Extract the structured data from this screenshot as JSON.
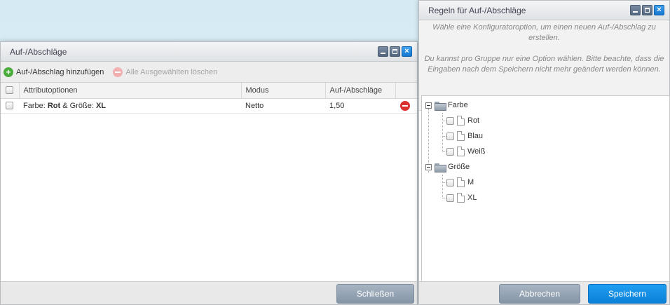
{
  "left_window": {
    "title": "Auf-/Abschläge",
    "toolbar": {
      "add_label": "Auf-/Abschlag hinzufügen",
      "delete_selected_label": "Alle Ausgewählten löschen"
    },
    "table": {
      "columns": [
        "Attributoptionen",
        "Modus",
        "Auf-/Abschläge"
      ],
      "rows": [
        {
          "attr_prefix1": "Farbe: ",
          "attr_value1": "Rot",
          "attr_mid": " & Größe: ",
          "attr_value2": "XL",
          "mode": "Netto",
          "amount": "1,50"
        }
      ]
    },
    "close_button": "Schließen"
  },
  "right_window": {
    "title": "Regeln für Auf-/Abschläge",
    "info_text1": "Wähle eine Konfiguratoroption, um einen neuen Auf-/Abschlag zu erstellen.",
    "info_text2": "Du kannst pro Gruppe nur eine Option wählen. Bitte beachte, dass die Eingaben nach dem Speichern nicht mehr geändert werden können.",
    "tree": {
      "groups": [
        {
          "label": "Farbe",
          "options": [
            "Rot",
            "Blau",
            "Weiß"
          ]
        },
        {
          "label": "Größe",
          "options": [
            "M",
            "XL"
          ]
        }
      ]
    },
    "cancel_button": "Abbrechen",
    "save_button": "Speichern"
  },
  "icons": {
    "minimize": "minimize-icon",
    "maximize": "maximize-icon",
    "close": "close-icon",
    "add": "add-icon",
    "delete": "delete-icon",
    "folder": "folder-icon",
    "document": "document-icon"
  },
  "colors": {
    "accent_blue": "#1f9ef0",
    "gray_button": "#95a3b3",
    "add_green": "#4bab3c",
    "delete_red": "#d9322f"
  }
}
